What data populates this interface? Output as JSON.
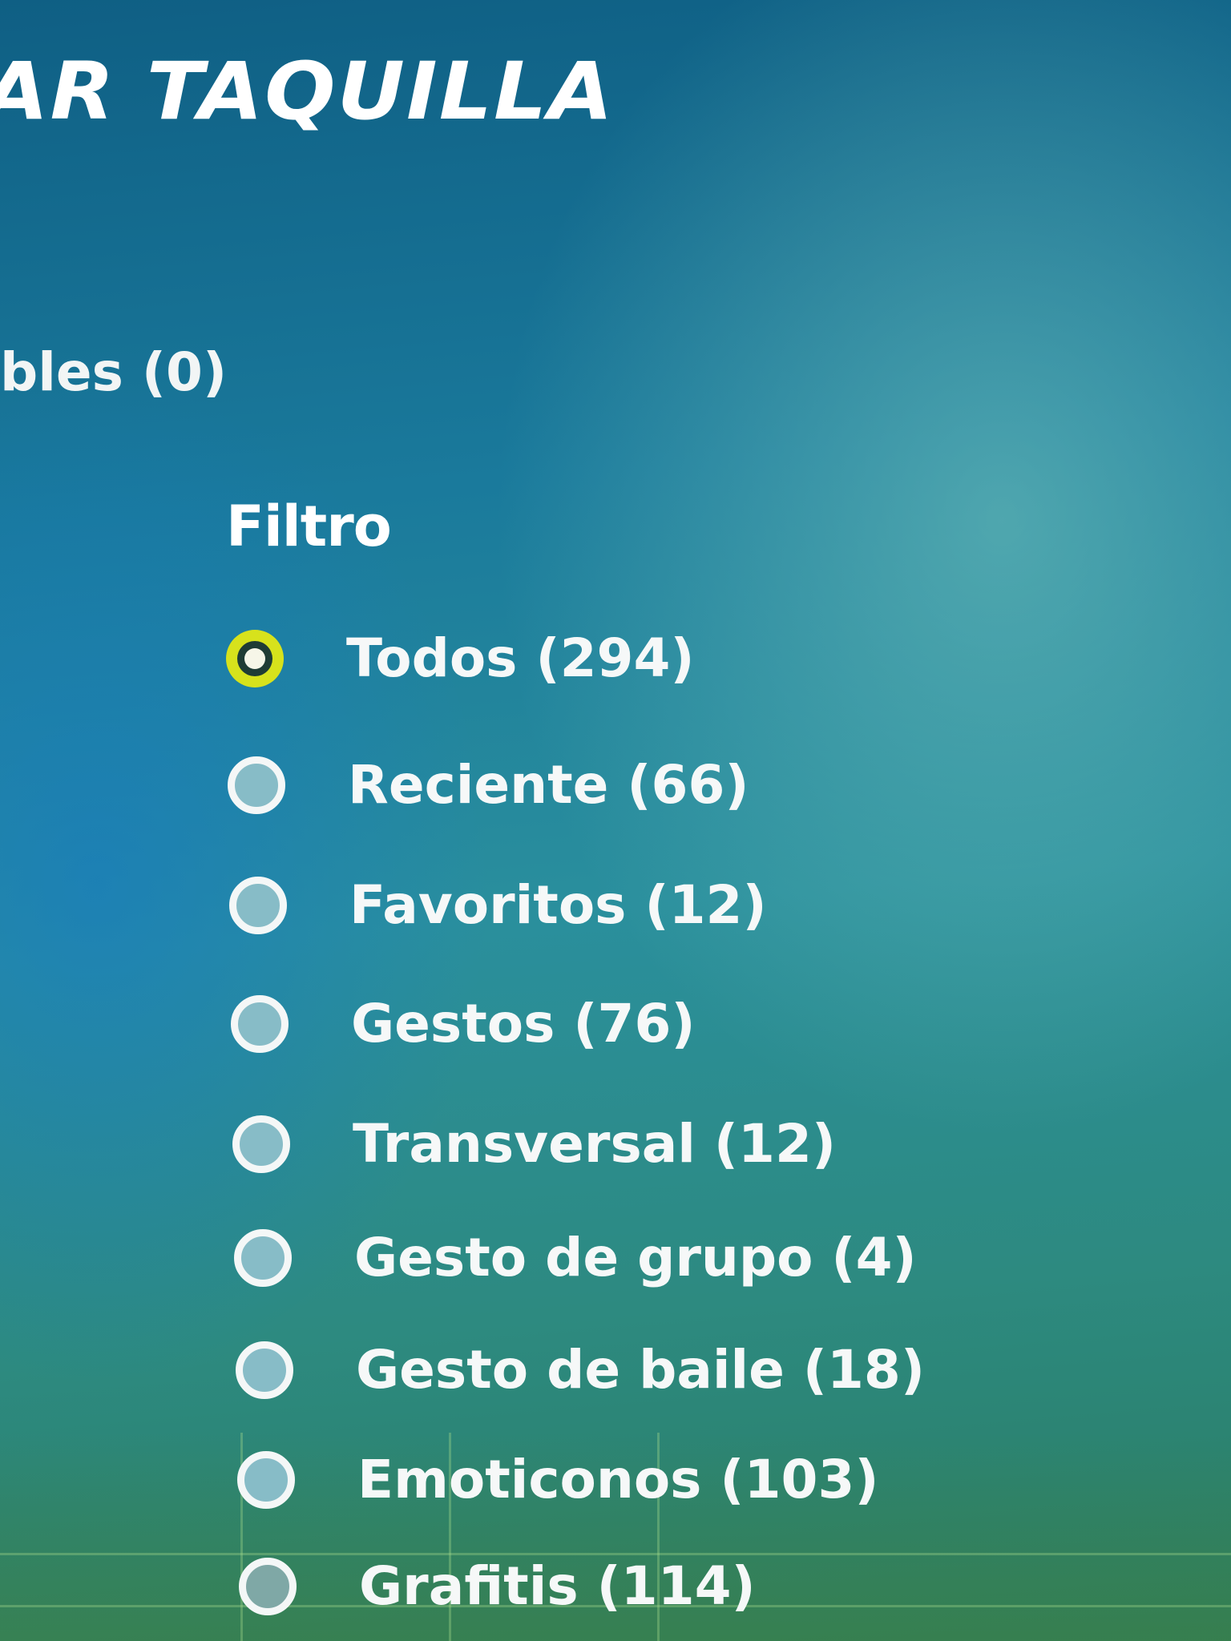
{
  "header": {
    "title": "AR TAQUILLA"
  },
  "tabs": {
    "partial_tab_label": "bles (0)"
  },
  "filter": {
    "heading": "Filtro",
    "selected_index": 0,
    "items": [
      {
        "label": "Todos (294)",
        "selected": true
      },
      {
        "label": "Reciente (66)",
        "selected": false
      },
      {
        "label": "Favoritos (12)",
        "selected": false
      },
      {
        "label": "Gestos (76)",
        "selected": false
      },
      {
        "label": "Transversal (12)",
        "selected": false
      },
      {
        "label": "Gesto de grupo (4)",
        "selected": false
      },
      {
        "label": "Gesto de baile (18)",
        "selected": false
      },
      {
        "label": "Emoticonos (103)",
        "selected": false
      },
      {
        "label": "Grafitis (114)",
        "selected": false
      }
    ]
  },
  "colors": {
    "selected_radio": "#d7e21c",
    "unselected_radio_fill": "#87bcc7",
    "text": "#ffffff"
  }
}
